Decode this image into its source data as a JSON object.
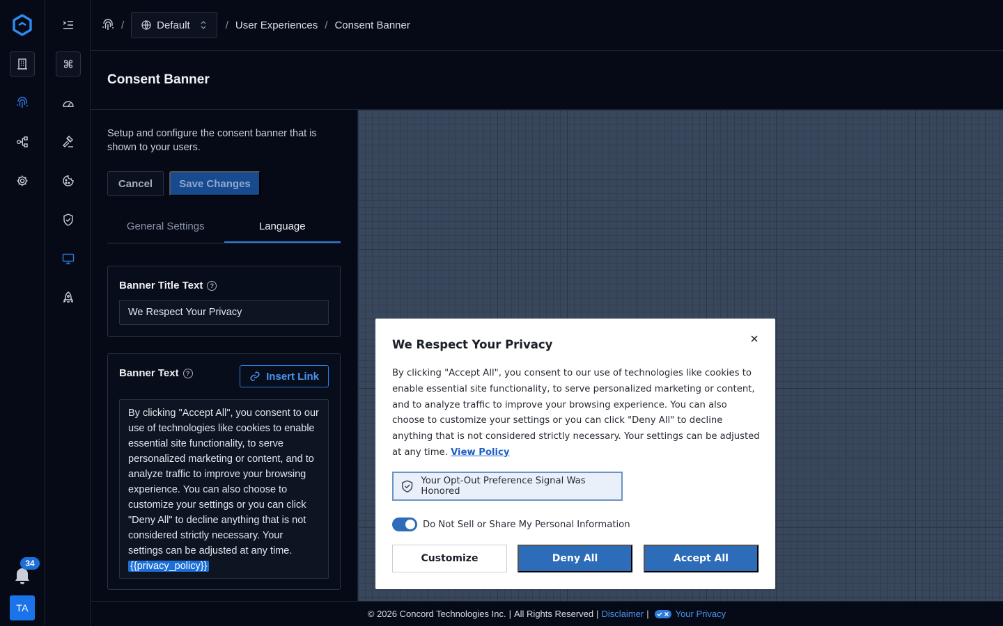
{
  "breadcrumb": {
    "environment": "Default",
    "sep": "/",
    "items": [
      "User Experiences",
      "Consent Banner"
    ]
  },
  "page": {
    "title": "Consent Banner",
    "description": "Setup and configure the consent banner that is shown to your users."
  },
  "actions": {
    "cancel": "Cancel",
    "save": "Save Changes"
  },
  "tabs": [
    {
      "label": "General Settings",
      "active": false
    },
    {
      "label": "Language",
      "active": true
    }
  ],
  "fields": {
    "banner_title": {
      "label": "Banner Title Text",
      "value": "We Respect Your Privacy"
    },
    "banner_text": {
      "label": "Banner Text",
      "insert_link": "Insert Link",
      "value": "By clicking \"Accept All\", you consent to our use of technologies like cookies to enable essential site functionality, to serve personalized marketing or content, and to analyze traffic to improve your browsing experience. You can also choose to customize your settings or you can click \"Deny All\" to decline anything that is not considered strictly necessary. Your settings can be adjusted at any time.",
      "token": "{{privacy_policy}}"
    }
  },
  "banner": {
    "title": "We Respect Your Privacy",
    "body": "By clicking \"Accept All\", you consent to our use of technologies like cookies to enable essential site functionality, to serve personalized marketing or content, and to analyze traffic to improve your browsing experience. You can also choose to customize your settings or you can click \"Deny All\" to decline anything that is not considered strictly necessary. Your settings can be adjusted at any time.",
    "policy_link": "View Policy",
    "gpc_notice": "Your Opt-Out Preference Signal Was Honored",
    "toggle_label": "Do Not Sell or Share My Personal Information",
    "toggle_on": true,
    "customize": "Customize",
    "deny": "Deny All",
    "accept": "Accept All"
  },
  "notifications": {
    "count": "34"
  },
  "user": {
    "initials": "TA"
  },
  "footer": {
    "copyright": "© 2026 Concord Technologies Inc.",
    "sep": "|",
    "rights": "All Rights Reserved",
    "disclaimer": "Disclaimer",
    "privacy": "Your Privacy"
  },
  "colors": {
    "accent": "#2d7be0",
    "banner_button": "#2d6cb8",
    "background": "#050a16",
    "canvas": "#39475c"
  }
}
